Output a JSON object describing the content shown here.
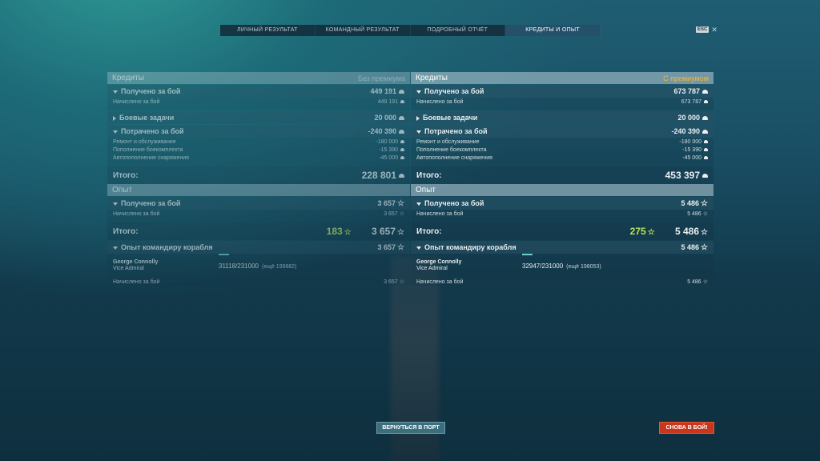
{
  "tabs": [
    "ЛИЧНЫЙ РЕЗУЛЬТАТ",
    "КОМАНДНЫЙ РЕЗУЛЬТАТ",
    "ПОДРОБНЫЙ ОТЧЁТ",
    "КРЕДИТЫ И ОПЫТ"
  ],
  "esc": "ESC",
  "left": {
    "credits_title": "Кредиты",
    "badge": "Без премиума",
    "earned_label": "Получено за бой",
    "earned": "449 191",
    "accrued_label": "Начислено за бой",
    "accrued": "449 191",
    "tasks_label": "Боевые задачи",
    "tasks": "20 000",
    "spent_label": "Потрачено за бой",
    "spent": "-240 390",
    "repair_label": "Ремонт и обслуживание",
    "repair": "-180 000",
    "ammo_label": "Пополнение боекомплекта",
    "ammo": "-15 390",
    "consumables_label": "Автопополнение снаряжения",
    "consumables": "-45 000",
    "total_label": "Итого:",
    "total": "228 801",
    "xp_title": "Опыт",
    "xp_earned_label": "Получено за бой",
    "xp_earned": "3 657",
    "xp_accrued_label": "Начислено за бой",
    "xp_accrued": "3 657",
    "xp_total_label": "Итого:",
    "xp_free": "183",
    "xp_total": "3 657",
    "cmd_label": "Опыт командиру корабля",
    "cmd_xp": "3 657",
    "cmd_name": "George Connolly",
    "cmd_rank": "Vice Admiral",
    "cmd_cur": "31118",
    "cmd_max": "/231000",
    "cmd_rest": "(ещё 199882)",
    "cmd_accrued_label": "Начислено за бой",
    "cmd_accrued": "3 657"
  },
  "right": {
    "credits_title": "Кредиты",
    "badge": "С премиумом",
    "earned_label": "Получено за бой",
    "earned": "673 787",
    "accrued_label": "Начислено за бой",
    "accrued": "673 787",
    "tasks_label": "Боевые задачи",
    "tasks": "20 000",
    "spent_label": "Потрачено за бой",
    "spent": "-240 390",
    "repair_label": "Ремонт и обслуживание",
    "repair": "-180 000",
    "ammo_label": "Пополнение боекомплекта",
    "ammo": "-15 390",
    "consumables_label": "Автопополнение снаряжения",
    "consumables": "-45 000",
    "total_label": "Итого:",
    "total": "453 397",
    "xp_title": "Опыт",
    "xp_earned_label": "Получено за бой",
    "xp_earned": "5 486",
    "xp_accrued_label": "Начислено за бой",
    "xp_accrued": "5 486",
    "xp_total_label": "Итого:",
    "xp_free": "275",
    "xp_total": "5 486",
    "cmd_label": "Опыт командиру корабля",
    "cmd_xp": "5 486",
    "cmd_name": "George Connolly",
    "cmd_rank": "Vice Admiral",
    "cmd_cur": "32947",
    "cmd_max": "/231000",
    "cmd_rest": "(ещё 198053)",
    "cmd_accrued_label": "Начислено за бой",
    "cmd_accrued": "5 486"
  },
  "buttons": {
    "port": "ВЕРНУТЬСЯ В ПОРТ",
    "battle": "СНОВА В БОЙ!"
  },
  "colors": {
    "premium_badge": "#f7b731",
    "free_xp": "#b8e35a",
    "battle_button": "#c8361c"
  },
  "icons": {
    "credits": "credits-icon",
    "xp": "star-icon"
  }
}
